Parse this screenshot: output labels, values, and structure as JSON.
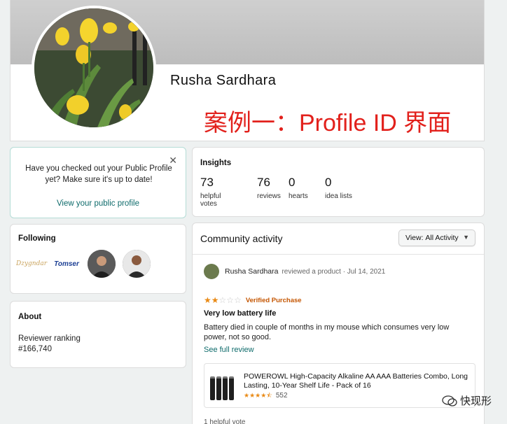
{
  "profile": {
    "name": "Rusha Sardhara",
    "annotation": "案例一：Profile ID 界面"
  },
  "public_profile_prompt": {
    "message": "Have you checked out your Public Profile yet? Make sure it's up to date!",
    "close_icon": "close-icon",
    "link": "View your public profile"
  },
  "following": {
    "title": "Following",
    "items": [
      {
        "type": "logo",
        "text": "Dzygndar"
      },
      {
        "type": "logo",
        "text": "Tomser"
      },
      {
        "type": "avatar"
      },
      {
        "type": "avatar"
      }
    ]
  },
  "about": {
    "title": "About",
    "ranking_label": "Reviewer ranking",
    "ranking_value": "#166,740"
  },
  "insights": {
    "title": "Insights",
    "stats": [
      {
        "value": "73",
        "label": "helpful votes"
      },
      {
        "value": "76",
        "label": "reviews"
      },
      {
        "value": "0",
        "label": "hearts"
      },
      {
        "value": "0",
        "label": "idea lists"
      }
    ]
  },
  "activity": {
    "title": "Community activity",
    "view_label": "View:",
    "view_value": "All Activity",
    "review": {
      "reviewer": "Rusha Sardhara",
      "meta": "reviewed a product · Jul 14, 2021",
      "rating": 2,
      "max_rating": 5,
      "verified": "Verified Purchase",
      "title": "Very low battery life",
      "body": "Battery died in couple of months in my mouse which consumes very low power, not so good.",
      "see_full": "See full review",
      "product": {
        "title": "POWEROWL High-Capacity Alkaline AA AAA Batteries Combo, Long Lasting, 10-Year Shelf Life - Pack of 16",
        "rating": 4.5,
        "rating_count": "552"
      },
      "helpful": "1 helpful vote"
    }
  },
  "watermark": "快现形",
  "colors": {
    "accent_link": "#0e6b6b",
    "annotation_red": "#e2211c",
    "star": "#e98a16",
    "verified": "#c45500"
  }
}
